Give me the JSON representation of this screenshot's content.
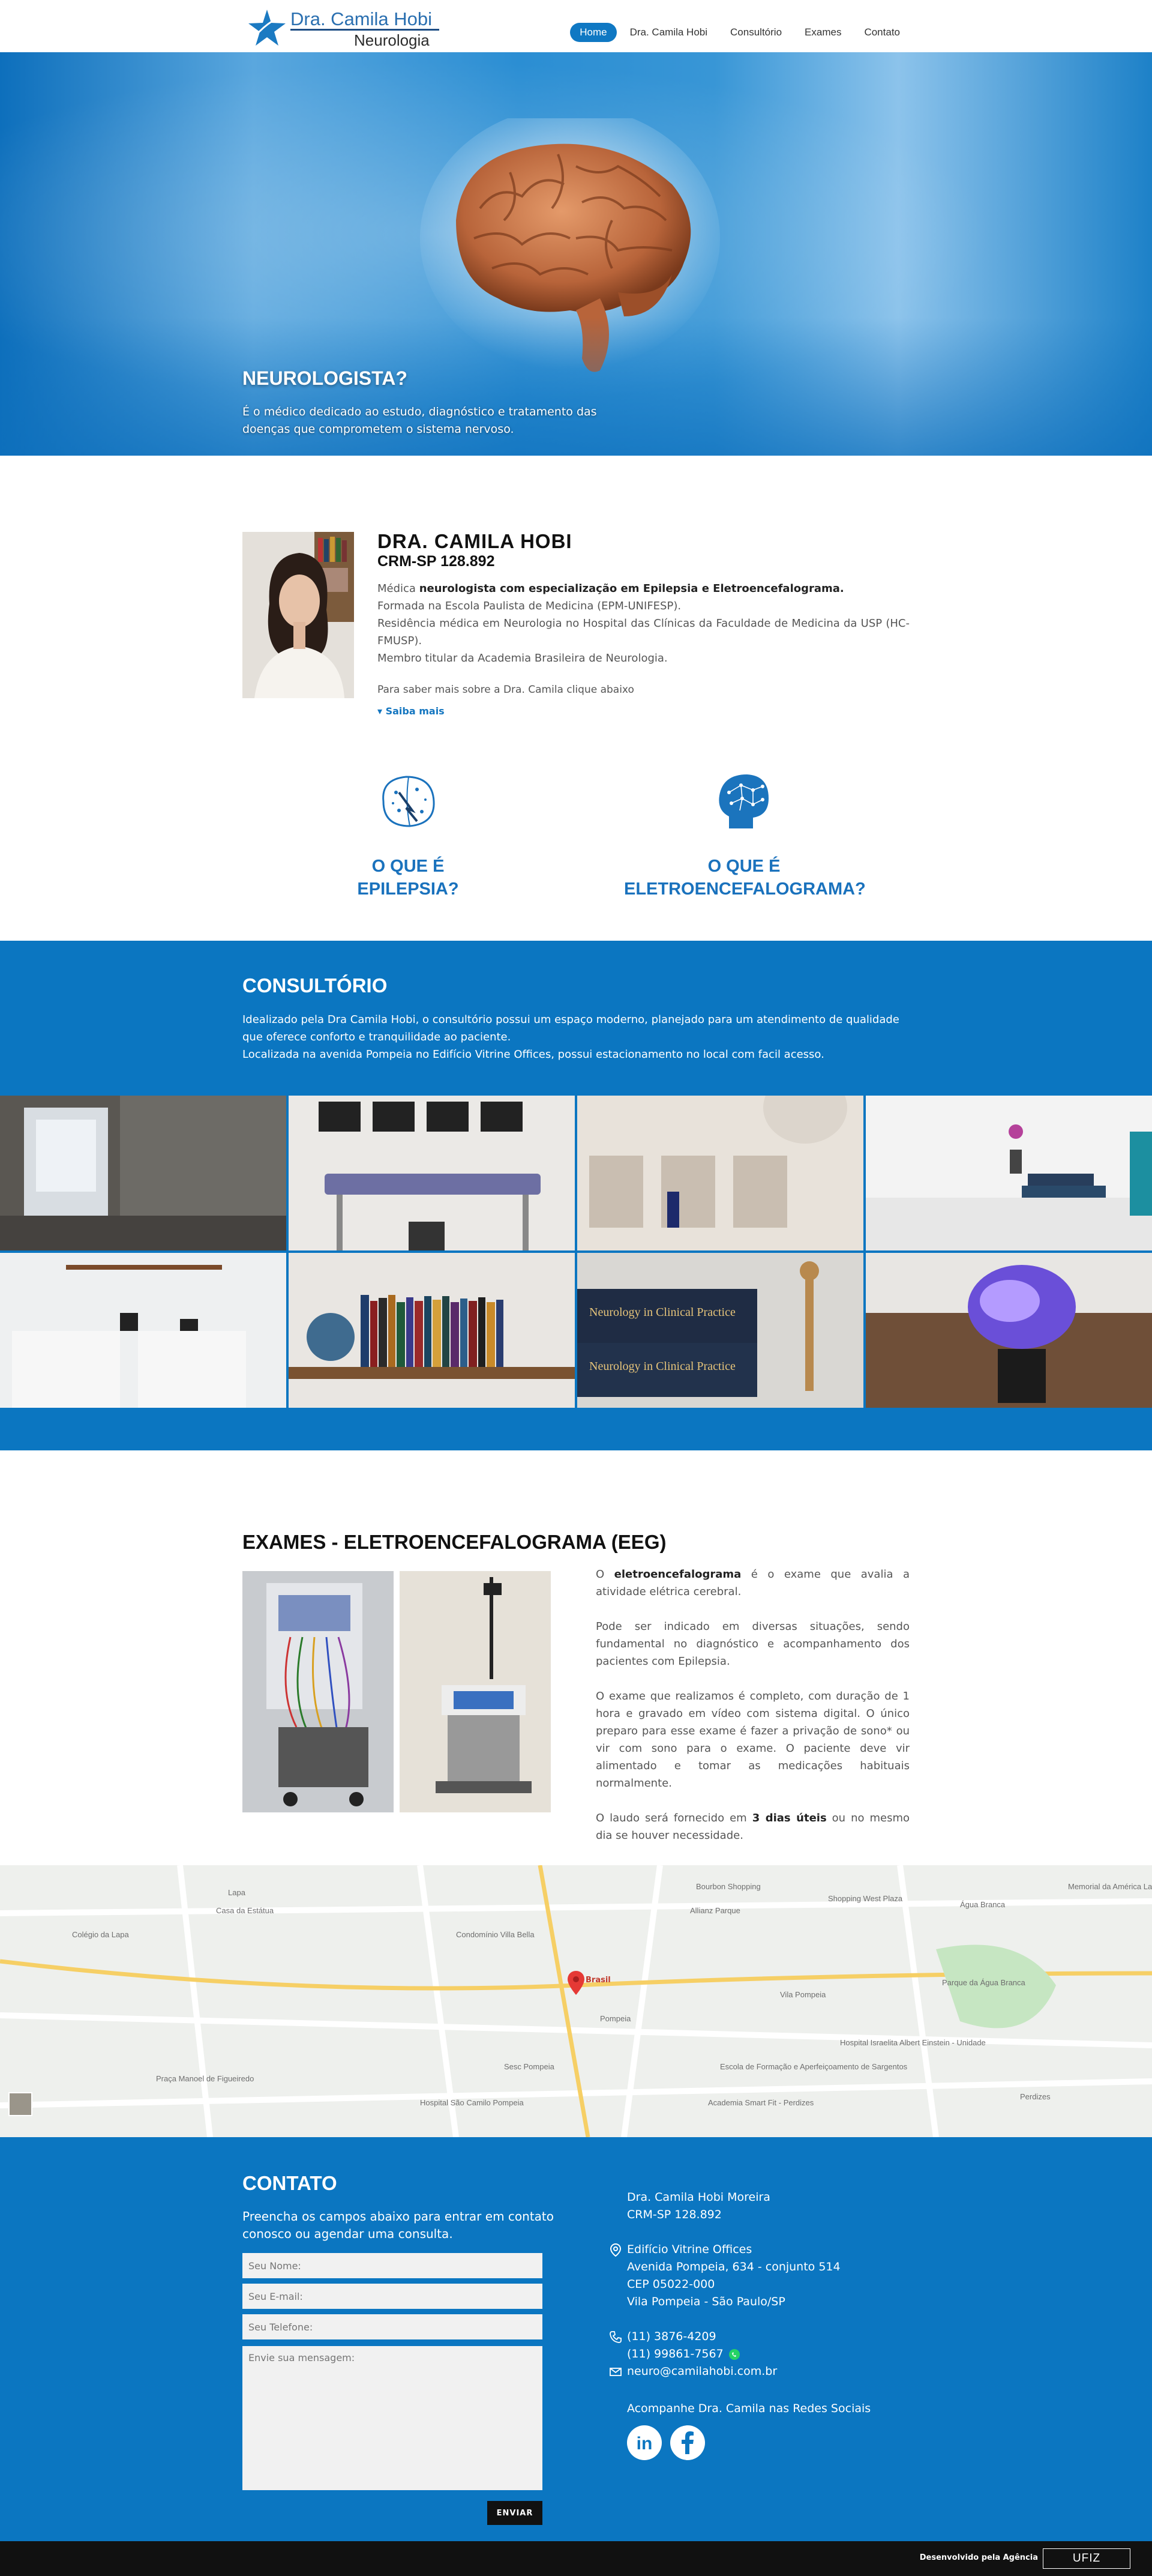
{
  "logo": {
    "line1": "Dra. Camila Hobi",
    "line2": "Neurologia"
  },
  "nav": {
    "items": [
      "Home",
      "Dra. Camila Hobi",
      "Consultório",
      "Exames",
      "Contato"
    ],
    "active": "Home"
  },
  "hero": {
    "title": "NEUROLOGISTA?",
    "text": "É o médico dedicado ao estudo, diagnóstico e tratamento das doenças que comprometem o sistema nervoso."
  },
  "profile": {
    "name": "DRA. CAMILA HOBI",
    "crm": "CRM-SP 128.892",
    "line1_pre": "Médica ",
    "line1_bold": "neurologista com especialização em Epilepsia e Eletroencefalograma.",
    "line2": "Formada na Escola Paulista de Medicina (EPM-UNIFESP).",
    "line3": "Residência médica em Neurologia no Hospital das Clínicas da Faculdade de Medicina da USP (HC-FMUSP).",
    "line4": "Membro titular da Academia Brasileira de Neurologia.",
    "more": "Para saber mais sobre a Dra. Camila clique abaixo",
    "saiba": "▾ Saiba mais"
  },
  "features": [
    {
      "line1": "O QUE É",
      "line2": "EPILEPSIA?"
    },
    {
      "line1": "O QUE É",
      "line2": "ELETROENCEFALOGRAMA?"
    }
  ],
  "consultorio": {
    "title": "CONSULTÓRIO",
    "text1": "Idealizado pela Dra Camila Hobi, o consultório possui um espaço moderno, planejado para um atendimento de qualidade que oferece conforto e tranquilidade ao paciente.",
    "text2": "Localizada na avenida Pompeia no Edifício Vitrine Offices, possui estacionamento no local com facil acesso.",
    "book_titles": [
      "Neurology in Clinical Practice",
      "Neurology in Clinical Practice"
    ]
  },
  "exames": {
    "title": "EXAMES - ELETROENCEFALOGRAMA (EEG)",
    "p1_pre": "O ",
    "p1_bold": "eletroencefalograma",
    "p1_post": " é o exame que avalia a atividade elétrica cerebral.",
    "p2": "Pode ser indicado em diversas situações, sendo fundamental no diagnóstico e acompanhamento dos pacientes com Epilepsia.",
    "p3": "O exame que realizamos é completo, com duração de 1 hora e gravado em vídeo com sistema digital. O único preparo para esse exame é fazer a privação de sono* ou vir com sono para o exame. O paciente deve vir alimentado e tomar as medicações habituais normalmente.",
    "p4_pre": "O laudo será fornecido em ",
    "p4_bold": "3 dias úteis",
    "p4_post": " ou no mesmo dia se houver necessidade."
  },
  "map": {
    "labels": [
      "Casa da Estátua",
      "Shopping West Plaza",
      "Allianz Parque",
      "Pompeia",
      "Sesc Pompeia",
      "Parque da Água Branca",
      "Bourbon Shopping",
      "Memorial da América Latina",
      "Hospital Israelita Albert Einstein - Unidade",
      "Brasil",
      "Vila Pompeia",
      "Perdizes",
      "Água Branca",
      "Academia Smart Fit - Perdizes",
      "Praça Manoel de Figueiredo",
      "Hospital São Camilo Pompeia",
      "Colégio da Lapa",
      "Lapa",
      "Condomínio Villa Bella",
      "Escola de Formação e Aperfeiçoamento de Sargentos"
    ],
    "pin_label": "Brasil"
  },
  "contato": {
    "title": "CONTATO",
    "intro": "Preencha os campos abaixo para entrar em contato conosco ou agendar uma consulta.",
    "name_placeholder": "Seu Nome:",
    "email_placeholder": "Seu E-mail:",
    "phone_placeholder": "Seu Telefone:",
    "message_placeholder": "Envie sua mensagem:",
    "send": "ENVIAR",
    "doctor": "Dra. Camila Hobi Moreira",
    "crm": "CRM-SP 128.892",
    "addr1": "Edifício Vitrine Offices",
    "addr2": "Avenida Pompeia, 634 - conjunto 514",
    "addr3": "CEP 05022-000",
    "addr4": "Vila Pompeia - São Paulo/SP",
    "phone1": "(11) 3876-4209",
    "phone2": "(11) 99861-7567",
    "email": "neuro@camilahobi.com.br",
    "social": "Acompanhe Dra. Camila nas Redes Sociais",
    "social_icons": [
      "linkedin-icon",
      "facebook-icon"
    ]
  },
  "footer": {
    "dev": "Desenvolvido pela Agência",
    "agency": "UFIZ"
  },
  "colors": {
    "primary": "#0b76c1",
    "accent": "#1a72bd",
    "dark": "#111111"
  }
}
